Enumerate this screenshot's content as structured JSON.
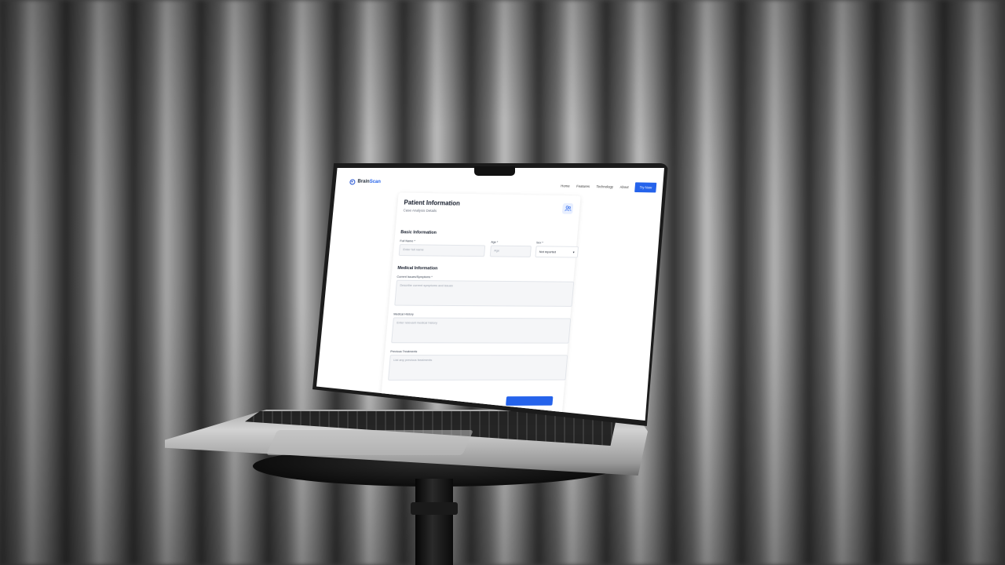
{
  "nav": {
    "brand_prefix": "Brain",
    "brand_accent": "Scan",
    "links": [
      "Home",
      "Features",
      "Technology",
      "About"
    ],
    "cta": "Try Now"
  },
  "form": {
    "title": "Patient Information",
    "subtitle": "Case Analysis Details",
    "basic": {
      "heading": "Basic Information",
      "full_name_label": "Full Name *",
      "full_name_placeholder": "Enter full name",
      "age_label": "Age *",
      "age_placeholder": "Age",
      "sex_label": "Sex *",
      "sex_value": "Not reported"
    },
    "medical": {
      "heading": "Medical Information",
      "symptoms_label": "Current Issues/Symptoms *",
      "symptoms_placeholder": "Describe current symptoms and issues",
      "history_label": "Medical History",
      "history_placeholder": "Enter relevant medical history",
      "treatments_label": "Previous Treatments",
      "treatments_placeholder": "List any previous treatments"
    }
  },
  "colors": {
    "accent": "#2563eb",
    "chip_bg": "#e8efff"
  }
}
